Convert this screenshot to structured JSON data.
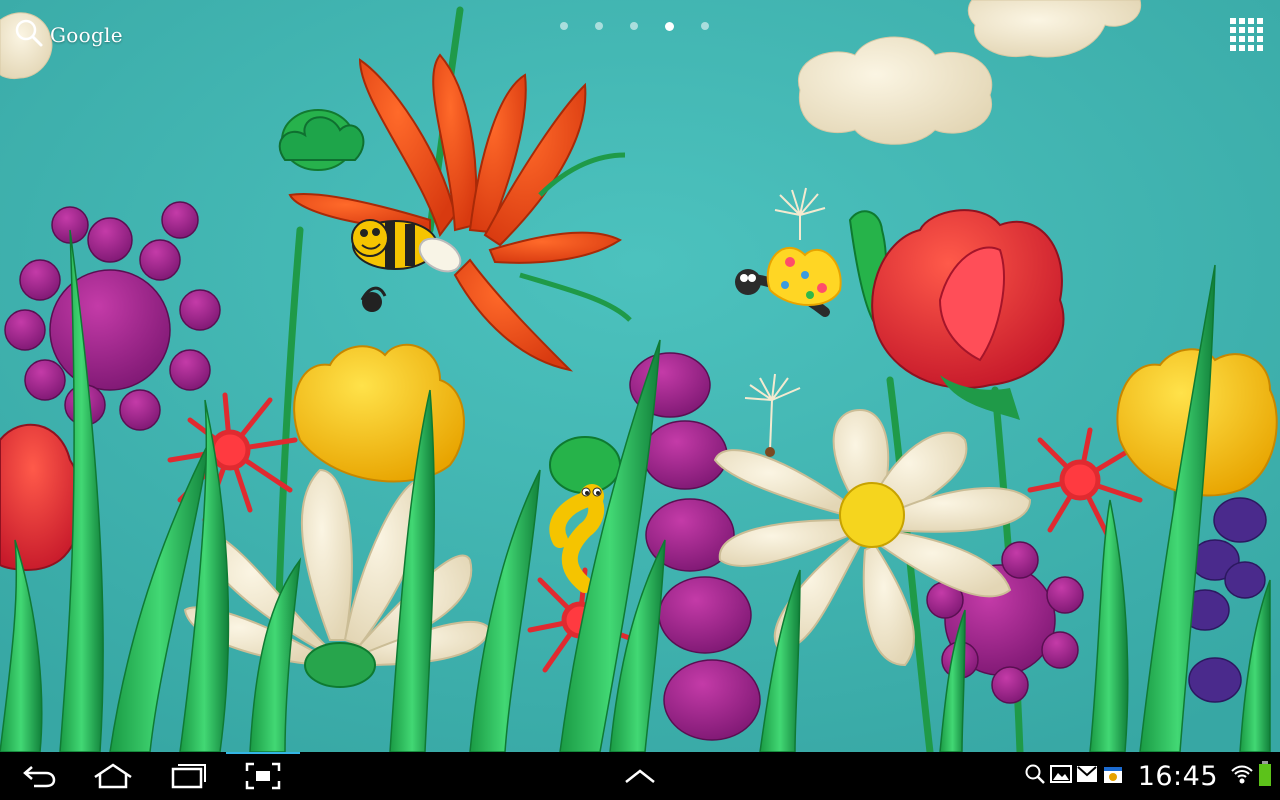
{
  "launcher": {
    "search_label": "Google",
    "pages": {
      "count": 5,
      "current": 4
    }
  },
  "status_bar": {
    "time": "16:45",
    "notification_icons": [
      "search-icon",
      "gallery-icon",
      "gmail-icon",
      "calendar-icon"
    ],
    "wifi": "connected",
    "battery_color": "#5cc21a"
  },
  "colors": {
    "sky": "#42b7b3",
    "accent": "#33b5e5"
  }
}
